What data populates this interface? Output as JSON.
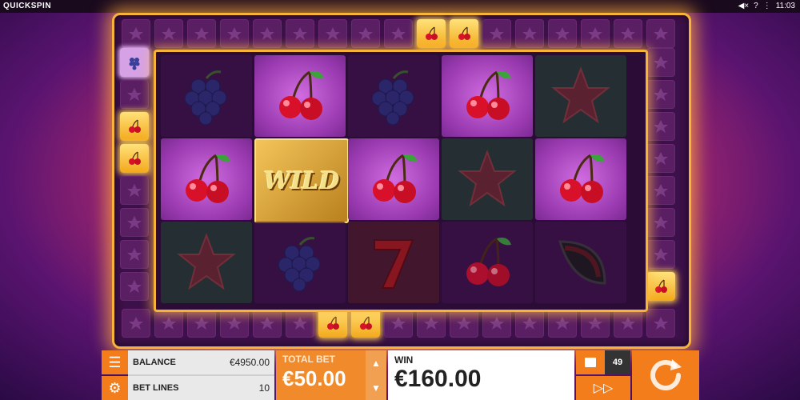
{
  "topbar": {
    "brand": "QUICKSPIN",
    "time": "11:03",
    "help": "?"
  },
  "grid": {
    "rows": [
      [
        "grapes",
        "cherry",
        "grapes",
        "cherry",
        "star"
      ],
      [
        "cherry",
        "wild",
        "cherry",
        "star",
        "cherry"
      ],
      [
        "star",
        "grapes",
        "seven",
        "cherry",
        "melon"
      ]
    ],
    "wild_label": "WILD"
  },
  "panel": {
    "balance_label": "BALANCE",
    "balance_value": "€4950.00",
    "betlines_label": "BET LINES",
    "betlines_value": "10",
    "totalbet_label": "TOTAL BET",
    "totalbet_value": "€50.00",
    "win_label": "WIN",
    "win_value": "€160.00",
    "autoplay_count": "49"
  },
  "colors": {
    "accent": "#f27d1a",
    "frame": "#f7b23a"
  }
}
